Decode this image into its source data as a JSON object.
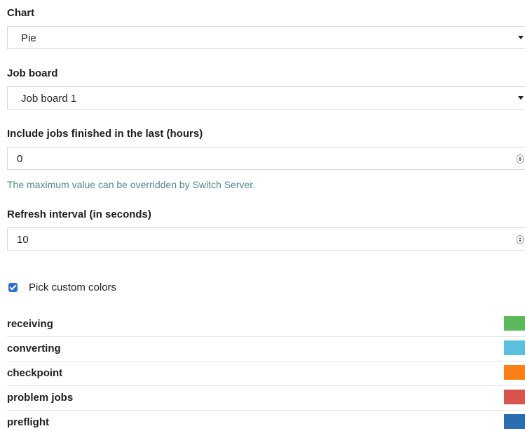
{
  "chart": {
    "label": "Chart",
    "value": "Pie"
  },
  "job_board": {
    "label": "Job board",
    "value": "Job board 1"
  },
  "include_jobs": {
    "label": "Include jobs finished in the last (hours)",
    "value": "0",
    "help": "The maximum value can be overridden by Switch Server."
  },
  "refresh": {
    "label": "Refresh interval (in seconds)",
    "value": "10"
  },
  "custom_colors": {
    "label": "Pick custom colors",
    "checked": true
  },
  "colors": [
    {
      "name": "receiving",
      "color": "#5cb85c"
    },
    {
      "name": "converting",
      "color": "#5bc0de"
    },
    {
      "name": "checkpoint",
      "color": "#fd7e14"
    },
    {
      "name": "problem jobs",
      "color": "#d9534f"
    },
    {
      "name": "preflight",
      "color": "#2a6db1"
    }
  ]
}
